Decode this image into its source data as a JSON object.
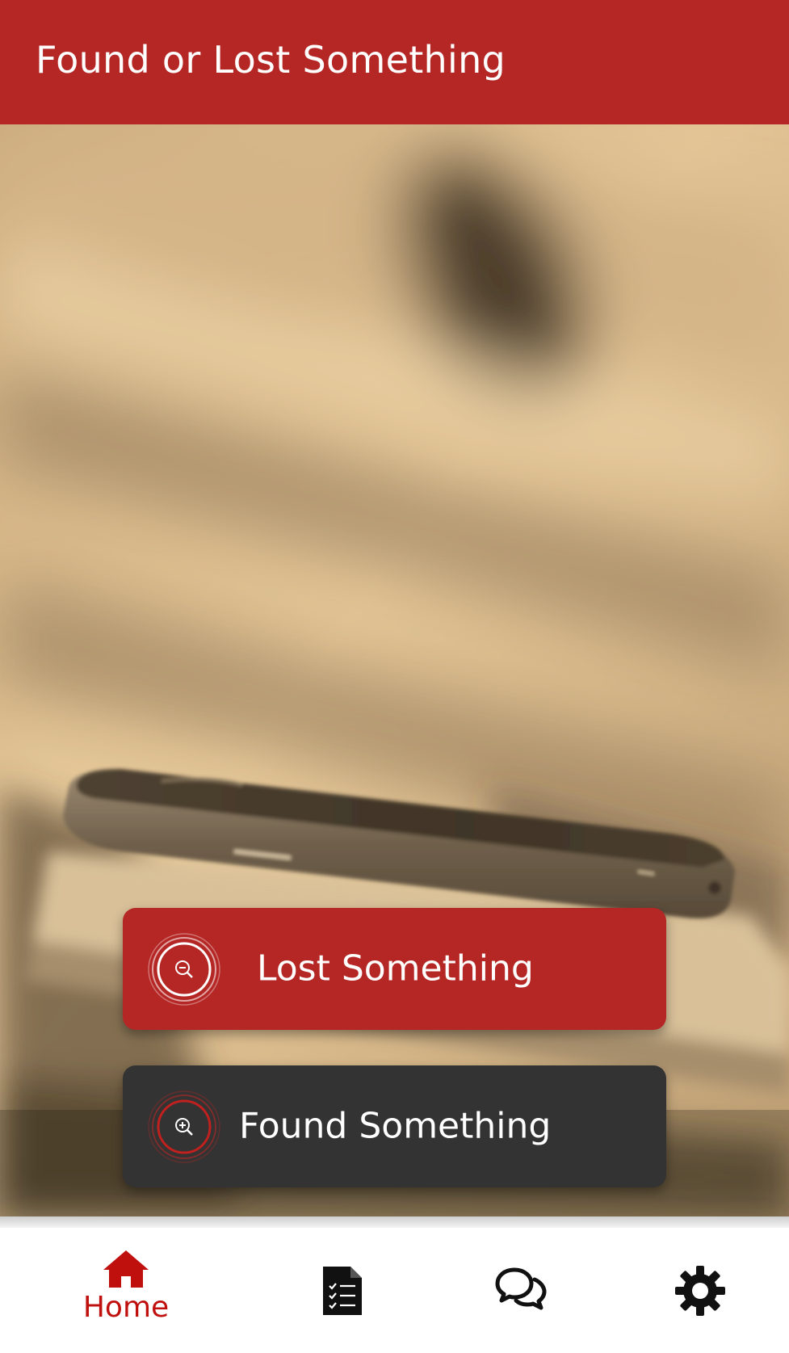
{
  "app_bar": {
    "title": "Found or Lost Something"
  },
  "hero": {
    "image": "phone-on-wooden-bench-photo"
  },
  "actions": {
    "lost": {
      "label": "Lost Something",
      "icon": "zoom-out-magnifier-icon"
    },
    "found": {
      "label": "Found Something",
      "icon": "zoom-in-magnifier-icon"
    }
  },
  "bottom_nav": {
    "items": [
      {
        "label": "Home",
        "icon": "home-icon",
        "active": true
      },
      {
        "label": "",
        "icon": "checklist-document-icon",
        "active": false
      },
      {
        "label": "",
        "icon": "chat-bubbles-icon",
        "active": false
      },
      {
        "label": "",
        "icon": "gear-icon",
        "active": false
      }
    ]
  },
  "colors": {
    "primary": "#b52725",
    "dark_button": "#333333",
    "active_nav": "#c0100e",
    "inactive_nav": "#111111"
  }
}
